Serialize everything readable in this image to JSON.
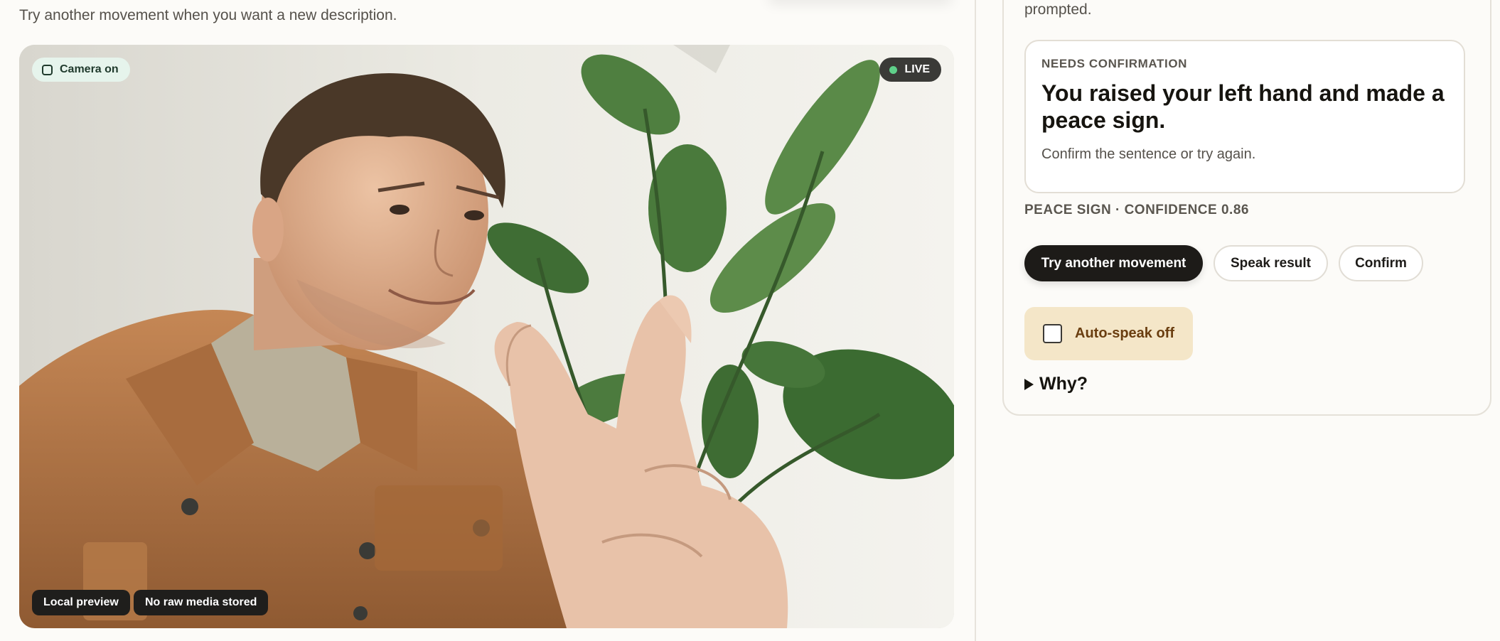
{
  "left": {
    "hint": "Try another movement when you want a new description.",
    "camera": {
      "status_label": "Camera on",
      "live_label": "LIVE",
      "tags": [
        "Local preview",
        "No raw media stored"
      ]
    }
  },
  "right": {
    "prompted_text": "prompted.",
    "result": {
      "kicker": "NEEDS CONFIRMATION",
      "title": "You raised your left hand and made a peace sign.",
      "subtitle": "Confirm the sentence or try again."
    },
    "confidence_line": "PEACE SIGN · CONFIDENCE 0.86",
    "buttons": {
      "try_again": "Try another movement",
      "speak": "Speak result",
      "confirm": "Confirm"
    },
    "auto_speak": {
      "label": "Auto-speak off",
      "checked": false
    },
    "why_label": "Why?"
  },
  "colors": {
    "accent_dark": "#1d1b18",
    "live_dot": "#5fd08a",
    "camera_pill_bg": "#e6f4ec",
    "autospeak_bg": "#f4e6c8",
    "autospeak_text": "#6a3e10"
  }
}
